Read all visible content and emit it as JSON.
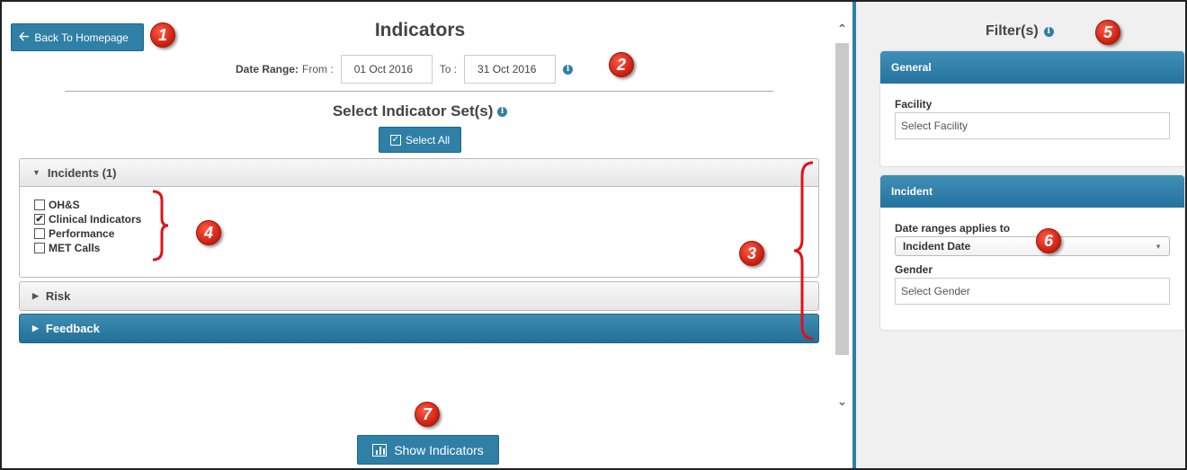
{
  "header": {
    "back_label": "Back To Homepage",
    "title": "Indicators",
    "date_range_label": "Date Range:",
    "from_label": "From :",
    "from_value": "01 Oct 2016",
    "to_label": "To :",
    "to_value": "31 Oct 2016"
  },
  "indicator_sets": {
    "title": "Select Indicator Set(s)",
    "select_all_label": "Select All",
    "sections": [
      {
        "label": "Incidents (1)",
        "expanded": true
      },
      {
        "label": "Risk",
        "expanded": false
      },
      {
        "label": "Feedback",
        "expanded": false
      }
    ],
    "incident_items": [
      {
        "label": "OH&S",
        "checked": false
      },
      {
        "label": "Clinical Indicators",
        "checked": true
      },
      {
        "label": "Performance",
        "checked": false
      },
      {
        "label": "MET Calls",
        "checked": false
      }
    ]
  },
  "footer": {
    "show_label": "Show Indicators"
  },
  "filters": {
    "title": "Filter(s)",
    "general": {
      "header": "General",
      "facility_label": "Facility",
      "facility_placeholder": "Select Facility"
    },
    "incident": {
      "header": "Incident",
      "date_applies_label": "Date ranges applies to",
      "date_applies_value": "Incident Date",
      "gender_label": "Gender",
      "gender_placeholder": "Select Gender"
    }
  },
  "annotations": [
    "1",
    "2",
    "3",
    "4",
    "5",
    "6",
    "7"
  ],
  "colors": {
    "primary": "#2f7fa6",
    "annotation_red": "#d42a18",
    "panel_bg": "#f0f0f0"
  }
}
